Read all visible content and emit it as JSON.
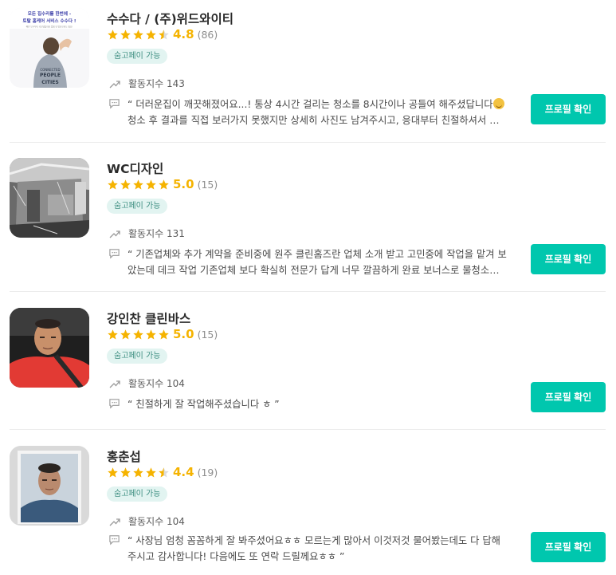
{
  "experts": [
    {
      "name": "수수다 / (주)위드와이티",
      "stars": 4.5,
      "score": "4.8",
      "review_count": "(86)",
      "badge": "숨고페이 가능",
      "activity": "활동지수 143",
      "review_before": "“ 더러운집이 깨끗해졌어요...! 통상 4시간 걸리는 청소를 8시간이나 공들여 해주셨답니다",
      "review_after": "청소 후 결과를 직접 보러가지 못했지만 상세히 사진도 남겨주시고, 응대부터 친절하셔서 믿음이 ...",
      "button": "프로필 확인",
      "thumb": {
        "line1": "모든 집수리를 한번에 -",
        "line2": "토탈 홈케어 서비스 수수다 !",
        "line3": "빠른 보수부터 리모델링까지 업체 안 알아보셔도 돼요!",
        "shirt": "PEOPLE CITIES"
      }
    },
    {
      "name": "WC디자인",
      "stars": 5,
      "score": "5.0",
      "review_count": "(15)",
      "badge": "숨고페이 가능",
      "activity": "활동지수 131",
      "review_before": "“ 기존업체와 추가 계약을 준비중에 원주 클린홈즈란 업체 소개 받고 고민중에 작업을 맡겨 보았는데 데크 작업 기존업체 보다 확실히 전문가 답게 너무 깔끔하게 완료 보너스로 물청소까지 강...",
      "review_after": "",
      "button": "프로필 확인"
    },
    {
      "name": "강인찬 클린바스",
      "stars": 5,
      "score": "5.0",
      "review_count": "(15)",
      "badge": "숨고페이 가능",
      "activity": "활동지수 104",
      "review_before": "“ 친절하게 잘 작업해주셨습니다 ㅎ ”",
      "review_after": "",
      "button": "프로필 확인"
    },
    {
      "name": "홍춘섭",
      "stars": 4.5,
      "score": "4.4",
      "review_count": "(19)",
      "badge": "숨고페이 가능",
      "activity": "활동지수 104",
      "review_before": "“ 사장님 엄청 꼼꼼하게 잘 봐주셨어요ㅎㅎ 모르는게 많아서 이것저것 물어봤는데도 다 답해주시고 감사합니다! 다음에도 또 연락 드릴께요ㅎㅎ ”",
      "review_after": "",
      "button": "프로필 확인"
    }
  ],
  "colors": {
    "accent": "#00c7ae",
    "star": "#f5b300",
    "badge_bg": "#e2f4f1",
    "badge_text": "#3f8f82"
  },
  "icons": [
    "star-icon",
    "trend-up-icon",
    "chat-bubble-icon"
  ]
}
